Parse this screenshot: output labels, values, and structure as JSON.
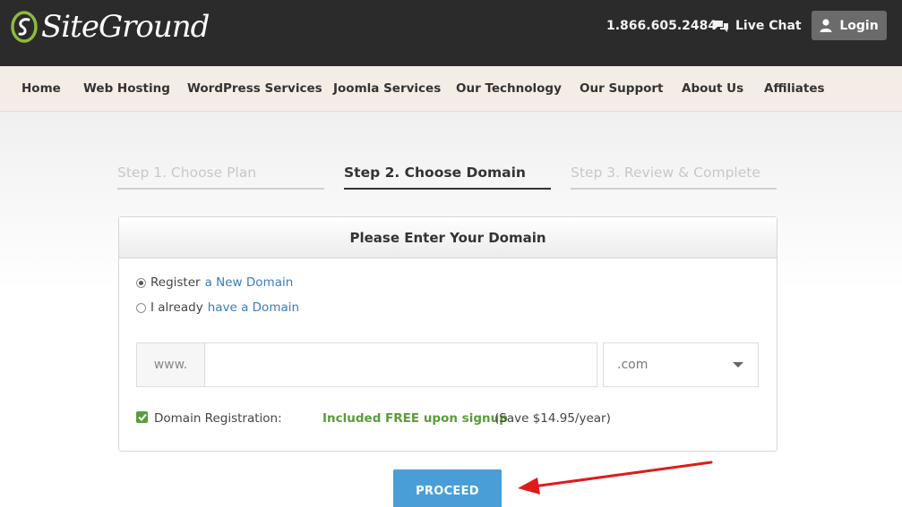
{
  "header": {
    "logo_text": "SiteGround",
    "phone": "1.866.605.2484",
    "live_chat_label": "Live Chat",
    "login_label": "Login"
  },
  "nav": {
    "items": [
      "Home",
      "Web Hosting",
      "WordPress Services",
      "Joomla Services",
      "Our Technology",
      "Our Support",
      "About Us",
      "Affiliates"
    ]
  },
  "steps": [
    {
      "label": "Step 1. Choose Plan",
      "state": "inactive"
    },
    {
      "label": "Step 2. Choose Domain",
      "state": "active"
    },
    {
      "label": "Step 3. Review & Complete",
      "state": "inactive"
    }
  ],
  "domain_card": {
    "title": "Please Enter Your Domain",
    "option_register": {
      "prefix": "Register ",
      "link": "a New Domain",
      "selected": true
    },
    "option_existing": {
      "prefix": "I already ",
      "link": "have a Domain",
      "selected": false
    },
    "www_prefix": "www.",
    "domain_value": "",
    "domain_placeholder": "",
    "tld_selected": ".com",
    "registration_label": "Domain Registration:",
    "registration_free": "Included FREE upon signup",
    "registration_savings": "(Save $14.95/year)",
    "registration_checked": true
  },
  "proceed_label": "PROCEED",
  "colors": {
    "topbar": "#2b2b2b",
    "navbar": "#f4ede6",
    "accent_blue": "#4a9ed8",
    "link_blue": "#3a7bbd",
    "free_green": "#5a9c3b",
    "annotation_red": "#e01b1b"
  }
}
